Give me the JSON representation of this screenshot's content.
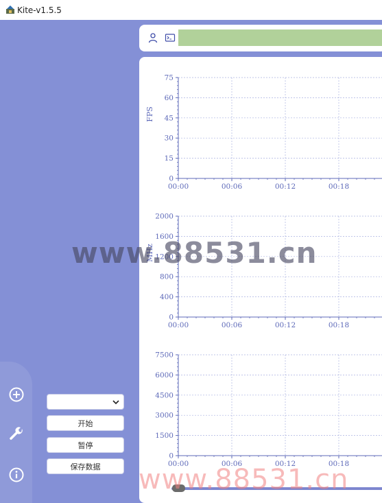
{
  "window": {
    "title": "Kite-v1.5.5"
  },
  "sidebar": {
    "icons": [
      "plus-circle-icon",
      "wrench-icon",
      "info-icon"
    ],
    "controls": {
      "device_select_value": "",
      "start_label": "开始",
      "pause_label": "暂停",
      "save_label": "保存数据"
    }
  },
  "topbar": {
    "icons": [
      "user-icon",
      "terminal-icon"
    ],
    "status_color": "#b1d19a"
  },
  "colors": {
    "accent": "#8490d6",
    "axis": "#5c68b8",
    "grid": "#aab1e0"
  },
  "chart_data": [
    {
      "type": "line",
      "ylabel": "FPS",
      "xlabel": "",
      "ylim": [
        0,
        75
      ],
      "yticks": [
        "0",
        "15",
        "30",
        "45",
        "60",
        "75"
      ],
      "xticks": [
        "00:00",
        "00:06",
        "00:12",
        "00:18"
      ],
      "grid": true,
      "series": []
    },
    {
      "type": "line",
      "ylabel": "MHz",
      "xlabel": "",
      "ylim": [
        0,
        2000
      ],
      "yticks": [
        "0",
        "400",
        "800",
        "1200",
        "1600",
        "2000"
      ],
      "xticks": [
        "00:00",
        "00:06",
        "00:12",
        "00:18"
      ],
      "grid": true,
      "series": []
    },
    {
      "type": "line",
      "ylabel": "",
      "xlabel": "",
      "ylim": [
        0,
        7500
      ],
      "yticks": [
        "0",
        "1500",
        "3000",
        "4500",
        "6000",
        "7500"
      ],
      "xticks": [
        "00:00",
        "00:06",
        "00:12",
        "00:18"
      ],
      "grid": true,
      "series": []
    }
  ],
  "watermarks": [
    "www.88531.cn",
    "www.88531.cn"
  ]
}
